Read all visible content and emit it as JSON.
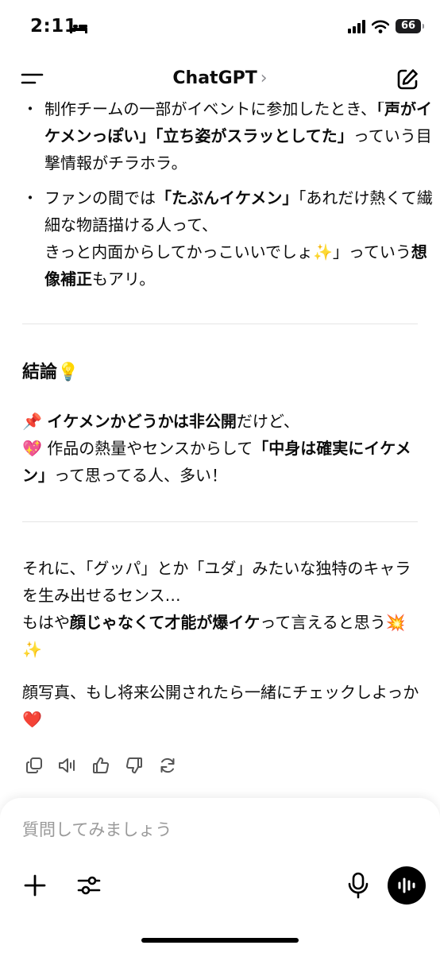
{
  "status": {
    "time": "2:11",
    "battery": "66"
  },
  "header": {
    "title": "ChatGPT",
    "chevron": "›"
  },
  "message": {
    "bullet_marker": "・",
    "bullet1": {
      "t1": "制作チームの一部がイベントに参加したとき、",
      "b1": "「声がイケメンっぽい」「立ち姿がスラッとしてた」",
      "t2": "っていう目撃情報がチラホラ。"
    },
    "bullet2": {
      "t1": "ファンの間では",
      "b1": "「たぶんイケメン」",
      "t2": "「あれだけ熱くて繊細な物語描ける人って、",
      "t3": "きっと内面からしてかっこいいでしょ✨」っていう",
      "b2": "想像補正",
      "t4": "もアリ。"
    },
    "conclusion_heading": "結論💡",
    "conclusion": {
      "pin": "📌",
      "b1": "イケメンかどうかは非公開",
      "t1": "だけど、",
      "heart": "💖",
      "t2": "作品の熱量やセンスからして",
      "b2": "「中身は確実にイケメン」",
      "t3": "って思ってる人、多い！"
    },
    "closing": {
      "t1": "それに、「グッパ」とか「ユダ」みたいな独特のキャラを生み出せるセンス…",
      "t2": "もはや",
      "b1": "顔じゃなくて才能が爆イケ",
      "t3": "って言えると思う💥✨"
    },
    "last": "顔写真、もし将来公開されたら一緒にチェックしよっか❤️"
  },
  "actions": [
    "copy-icon",
    "read-aloud-icon",
    "thumbs-up-icon",
    "thumbs-down-icon",
    "regenerate-icon"
  ],
  "composer": {
    "placeholder": "質問してみましょう"
  }
}
